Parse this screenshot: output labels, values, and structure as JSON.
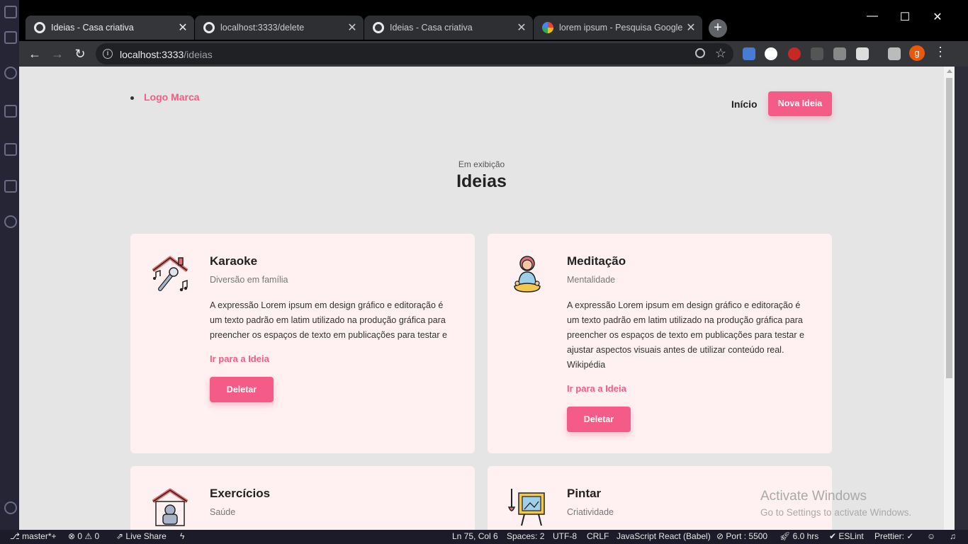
{
  "browser": {
    "tabs": [
      {
        "title": "Ideias - Casa criativa",
        "icon": "globe-icon",
        "state": "active"
      },
      {
        "title": "localhost:3333/delete",
        "icon": "globe-icon",
        "state": "inactive"
      },
      {
        "title": "Ideias - Casa criativa",
        "icon": "globe-icon",
        "state": "inactive"
      },
      {
        "title": "lorem ipsum - Pesquisa Google",
        "icon": "google-icon",
        "state": "inactive"
      }
    ],
    "tab_close": "✕",
    "new_tab": "+",
    "window_controls": {
      "minimize": "—",
      "maximize": "☐",
      "close": "✕"
    },
    "url_host": "localhost:3333",
    "url_path": "/ideias",
    "profile_initial": "g"
  },
  "page": {
    "logo": "Logo Marca",
    "nav_home": "Início",
    "nav_new_idea": "Nova Ideia",
    "section_subtitle": "Em exibição",
    "section_title": "Ideias",
    "cards": [
      {
        "title": "Karaoke",
        "category": "Diversão em família",
        "description": "A expressão Lorem ipsum em design gráfico e editoração é um texto padrão em latim utilizado na produção gráfica para preencher os espaços de texto em publicações para testar e",
        "link": "Ir para a Ideia",
        "delete": "Deletar",
        "icon": "karaoke-icon"
      },
      {
        "title": "Meditação",
        "category": "Mentalidade",
        "description": "A expressão Lorem ipsum em design gráfico e editoração é um texto padrão em latim utilizado na produção gráfica para preencher os espaços de texto em publicações para testar e ajustar aspectos visuais antes de utilizar conteúdo real. Wikipédia",
        "link": "Ir para a Ideia",
        "delete": "Deletar",
        "icon": "meditation-icon"
      },
      {
        "title": "Exercícios",
        "category": "Saúde",
        "icon": "exercise-icon"
      },
      {
        "title": "Pintar",
        "category": "Criatividade",
        "icon": "painting-icon"
      }
    ]
  },
  "watermark": {
    "line1": "Activate Windows",
    "line2": "Go to Settings to activate Windows."
  },
  "statusbar": {
    "branch": "master*+",
    "problems": "⊗ 0 ⚠ 0",
    "live_share": "Live Share",
    "position": "Ln 75, Col 6",
    "spaces": "Spaces: 2",
    "encoding": "UTF-8",
    "eol": "CRLF",
    "language": "JavaScript React (Babel)",
    "port": "Port : 5500",
    "time": "6.0 hrs",
    "eslint": "ESLint",
    "prettier": "Prettier: ✓"
  },
  "colors": {
    "accent": "#f45b86",
    "card_bg": "#fff0f2",
    "page_bg": "#e5e5e5"
  }
}
